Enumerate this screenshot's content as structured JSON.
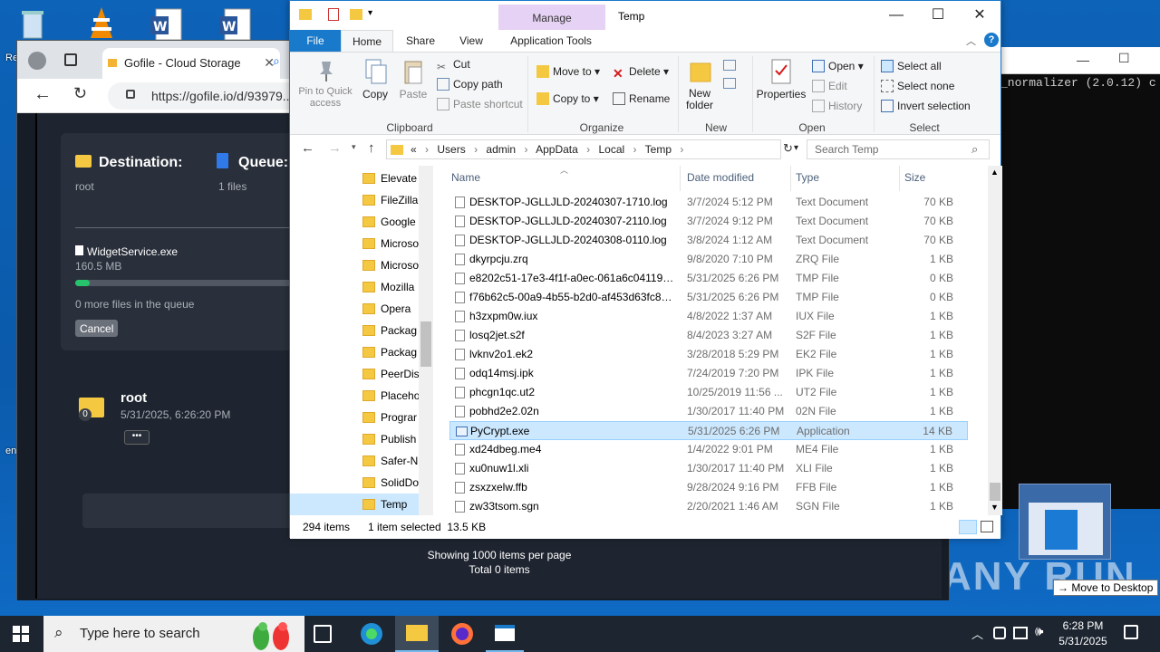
{
  "desktop": {
    "recycle_label": "Re",
    "edge_partial": "en"
  },
  "terminal": {
    "text": "_normalizer (2.0.12) c"
  },
  "snap": {
    "move_to_desktop": "Move to Desktop",
    "watermark": "ANY RUN"
  },
  "browser": {
    "tab_title": "Gofile - Cloud Storage",
    "url": "https://gofile.io/d/93979..."
  },
  "gofile": {
    "destination_label": "Destination:",
    "destination_value": "root",
    "queue_label": "Queue:",
    "queue_value": "1 files",
    "upload_file": "WidgetService.exe",
    "upload_size": "160.5 MB",
    "progress_fraction": 0.06,
    "more_files": "0 more files in the queue",
    "cancel_label": "Cancel",
    "root_name": "root",
    "root_date": "5/31/2025, 6:26:20 PM",
    "root_badge": "0",
    "dots_label": "•••",
    "showing": "Showing 1000 items per page",
    "total": "Total 0 items"
  },
  "explorer": {
    "title": "Temp",
    "manage_label": "Manage",
    "tabs": [
      "File",
      "Home",
      "Share",
      "View",
      "Application Tools"
    ],
    "ribbon": {
      "pin": "Pin to Quick access",
      "copy": "Copy",
      "paste": "Paste",
      "cut": "Cut",
      "copy_path": "Copy path",
      "paste_shortcut": "Paste shortcut",
      "clipboard": "Clipboard",
      "move_to": "Move to",
      "copy_to": "Copy to",
      "delete": "Delete",
      "rename": "Rename",
      "organize": "Organize",
      "new_folder": "New folder",
      "new": "New",
      "properties": "Properties",
      "open": "Open",
      "edit": "Edit",
      "history": "History",
      "open_group": "Open",
      "select_all": "Select all",
      "select_none": "Select none",
      "invert_selection": "Invert selection",
      "select_group": "Select"
    },
    "path": [
      "«",
      "Users",
      "admin",
      "AppData",
      "Local",
      "Temp"
    ],
    "search_placeholder": "Search Temp",
    "nav_items": [
      "Elevate",
      "FileZilla",
      "Google",
      "Microso",
      "Microso",
      "Mozilla",
      "Opera",
      "Packag",
      "Packag",
      "PeerDis",
      "Placeho",
      "Prograr",
      "Publish",
      "Safer-N",
      "SolidDo",
      "Temp"
    ],
    "columns": {
      "name": "Name",
      "date": "Date modified",
      "type": "Type",
      "size": "Size"
    },
    "files": [
      {
        "name": "DESKTOP-JGLLJLD-20240307-1710.log",
        "date": "3/7/2024 5:12 PM",
        "type": "Text Document",
        "size": "70 KB"
      },
      {
        "name": "DESKTOP-JGLLJLD-20240307-2110.log",
        "date": "3/7/2024 9:12 PM",
        "type": "Text Document",
        "size": "70 KB"
      },
      {
        "name": "DESKTOP-JGLLJLD-20240308-0110.log",
        "date": "3/8/2024 1:12 AM",
        "type": "Text Document",
        "size": "70 KB"
      },
      {
        "name": "dkyrpcju.zrq",
        "date": "9/8/2020 7:10 PM",
        "type": "ZRQ File",
        "size": "1 KB"
      },
      {
        "name": "e8202c51-17e3-4f1f-a0ec-061a6c041190.t...",
        "date": "5/31/2025 6:26 PM",
        "type": "TMP File",
        "size": "0 KB"
      },
      {
        "name": "f76b62c5-00a9-4b55-b2d0-af453d63fc8b....",
        "date": "5/31/2025 6:26 PM",
        "type": "TMP File",
        "size": "0 KB"
      },
      {
        "name": "h3zxpm0w.iux",
        "date": "4/8/2022 1:37 AM",
        "type": "IUX File",
        "size": "1 KB"
      },
      {
        "name": "losq2jet.s2f",
        "date": "8/4/2023 3:27 AM",
        "type": "S2F File",
        "size": "1 KB"
      },
      {
        "name": "lvknv2o1.ek2",
        "date": "3/28/2018 5:29 PM",
        "type": "EK2 File",
        "size": "1 KB"
      },
      {
        "name": "odq14msj.ipk",
        "date": "7/24/2019 7:20 PM",
        "type": "IPK File",
        "size": "1 KB"
      },
      {
        "name": "phcgn1qc.ut2",
        "date": "10/25/2019 11:56 ...",
        "type": "UT2 File",
        "size": "1 KB"
      },
      {
        "name": "pobhd2e2.02n",
        "date": "1/30/2017 11:40 PM",
        "type": "02N File",
        "size": "1 KB"
      },
      {
        "name": "PyCrypt.exe",
        "date": "5/31/2025 6:26 PM",
        "type": "Application",
        "size": "14 KB"
      },
      {
        "name": "xd24dbeg.me4",
        "date": "1/4/2022 9:01 PM",
        "type": "ME4 File",
        "size": "1 KB"
      },
      {
        "name": "xu0nuw1l.xli",
        "date": "1/30/2017 11:40 PM",
        "type": "XLI File",
        "size": "1 KB"
      },
      {
        "name": "zsxzxelw.ffb",
        "date": "9/28/2024 9:16 PM",
        "type": "FFB File",
        "size": "1 KB"
      },
      {
        "name": "zw33tsom.sgn",
        "date": "2/20/2021 1:46 AM",
        "type": "SGN File",
        "size": "1 KB"
      }
    ],
    "selected_index": 12,
    "status_items": "294 items",
    "status_selected": "1 item selected  13.5 KB"
  },
  "taskbar": {
    "search_placeholder": "Type here to search",
    "time": "6:28 PM",
    "date": "5/31/2025"
  }
}
